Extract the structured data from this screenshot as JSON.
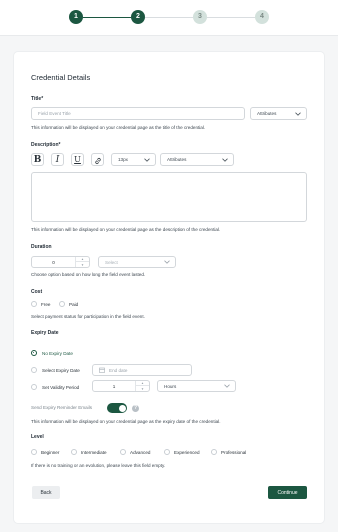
{
  "stepper": {
    "steps": [
      "1",
      "2",
      "3",
      "4"
    ],
    "current_step": 2
  },
  "colors": {
    "accent": "#1c5741",
    "inactive_step": "#d3e1dc",
    "border": "#d3d7db"
  },
  "card": {
    "title": "Credential Details"
  },
  "title_field": {
    "label": "Title*",
    "placeholder": "Field Event Title",
    "attributes_label": "Attributes",
    "help": "This information will be displayed on your credential page as the title of the credential."
  },
  "description_field": {
    "label": "Description*",
    "bold_glyph": "B",
    "italic_glyph": "I",
    "underline_glyph": "U",
    "link_icon": "link-icon",
    "font_size": "13px",
    "attributes_label": "Attributes",
    "help": "This information will be displayed on your credential page as the description of the credential."
  },
  "duration": {
    "label": "Duration",
    "value": "0",
    "unit_placeholder": "Select",
    "help": "Choose option based on how long the field event lasted."
  },
  "cost": {
    "label": "Cost",
    "options": [
      "Free",
      "Paid"
    ],
    "selected": null,
    "help": "Select payment status for participation in the field event."
  },
  "expiry": {
    "label": "Expiry Date",
    "options": {
      "no_expiry": "No Expiry Date",
      "select_expiry": "Select Expiry Date",
      "set_validity": "Set Validity Period"
    },
    "selected": "no_expiry",
    "end_date_placeholder": "End date",
    "validity_value": "1",
    "validity_unit": "Hours",
    "reminder_label": "Send Expiry Reminder Emails",
    "reminder_on": true,
    "info_glyph": "?",
    "help": "This information will be displayed on your credential page as the expiry date of the credential."
  },
  "level": {
    "label": "Level",
    "options": [
      "Beginner",
      "Intermediate",
      "Advanced",
      "Experienced",
      "Professional"
    ],
    "selected": null,
    "help": "If there is no training or an evolution, please leave this field empty."
  },
  "footer": {
    "back_label": "Back",
    "continue_label": "Continue"
  }
}
